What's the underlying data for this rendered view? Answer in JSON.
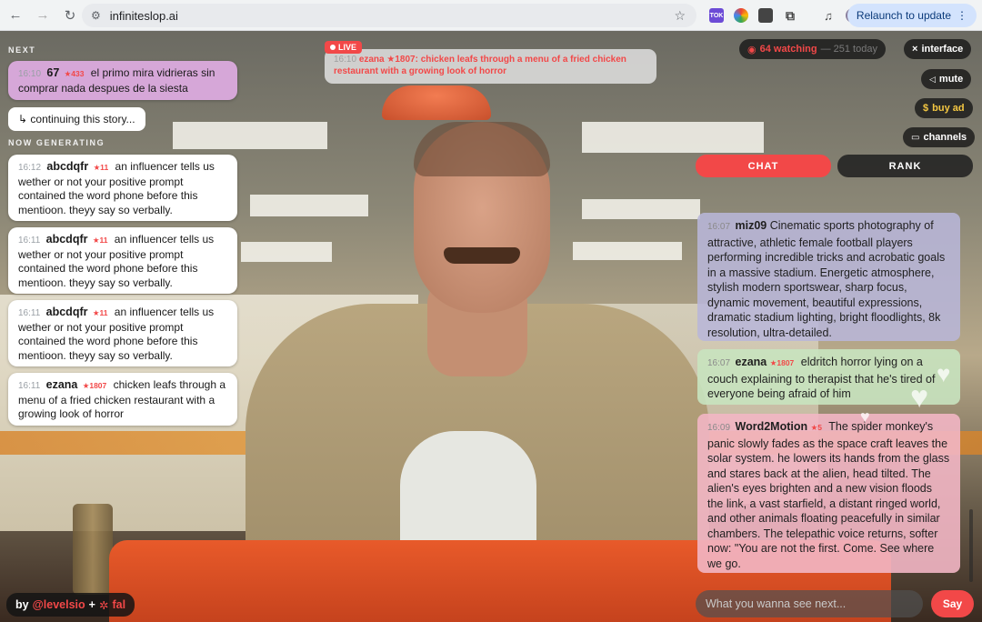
{
  "browser": {
    "url": "infiniteslop.ai",
    "relaunch_label": "Relaunch to update",
    "ext_tok": "TOK"
  },
  "left": {
    "next_label": "NEXT",
    "next_item": {
      "time": "16:10",
      "user": "67",
      "score": "★433",
      "text": "el primo mira vidrieras sin comprar nada despues de la siesta"
    },
    "continuing_label": "↳ continuing this story...",
    "generating_label": "NOW GENERATING",
    "generating": [
      {
        "time": "16:12",
        "user": "abcdqfr",
        "score": "★11",
        "text": "an influencer tells us wether or not your positive prompt contained the word phone before this mentioon. theyy say so verbally."
      },
      {
        "time": "16:11",
        "user": "abcdqfr",
        "score": "★11",
        "text": "an influencer tells us wether or not your positive prompt contained the word phone before this mentioon. theyy say so verbally."
      },
      {
        "time": "16:11",
        "user": "abcdqfr",
        "score": "★11",
        "text": "an influencer tells us wether or not your positive prompt contained the word phone before this mentioon. theyy say so verbally."
      },
      {
        "time": "16:11",
        "user": "ezana",
        "score": "★1807",
        "text": "chicken leafs through a menu of a fried chicken restaurant with a growing look of horror"
      }
    ]
  },
  "live": {
    "badge": "LIVE",
    "time": "16:10",
    "text": "ezana ★1807: chicken leafs through a menu of a fried chicken restaurant with a growing look of horror"
  },
  "right": {
    "watching": "64 watching",
    "today": "— 251 today",
    "interface_label": "interface",
    "mute_label": "mute",
    "buy_ad_label": "buy ad",
    "channels_label": "channels",
    "tab_chat": "CHAT",
    "tab_rank": "RANK",
    "chat": [
      {
        "time": "16:07",
        "user": "miz09",
        "score": "",
        "text": "Cinematic sports photography of attractive, athletic female football players performing incredible tricks and acrobatic goals in a massive stadium. Energetic atmosphere, stylish modern sportswear, sharp focus, dynamic movement, beautiful expressions, dramatic stadium lighting, bright floodlights, 8k resolution, ultra-detailed.",
        "color": "#b8b6d8"
      },
      {
        "time": "16:07",
        "user": "ezana",
        "score": "★1807",
        "text": "eldritch horror lying on a couch explaining to therapist that he's tired of everyone being afraid of him",
        "color": "#c8e3bf"
      },
      {
        "time": "16:09",
        "user": "Word2Motion",
        "score": "★5",
        "text": "The spider monkey's panic slowly fades as the space craft leaves the solar system. he lowers its hands from the glass and stares back at the alien, head tilted. The alien's eyes brighten and a new vision floods the link, a vast starfield, a distant ringed world, and other animals floating peacefully in similar chambers. The telepathic voice returns, softer now: \"You are not the first. Come. See where we go.",
        "color": "#f2b6c4"
      }
    ],
    "input_placeholder": "What you wanna see next...",
    "say_label": "Say"
  },
  "credit": {
    "by": "by",
    "handle": "@levelsio",
    "plus": "+",
    "fal": "fal"
  },
  "colors": {
    "accent": "#f24848",
    "dark_pill": "#141414"
  }
}
